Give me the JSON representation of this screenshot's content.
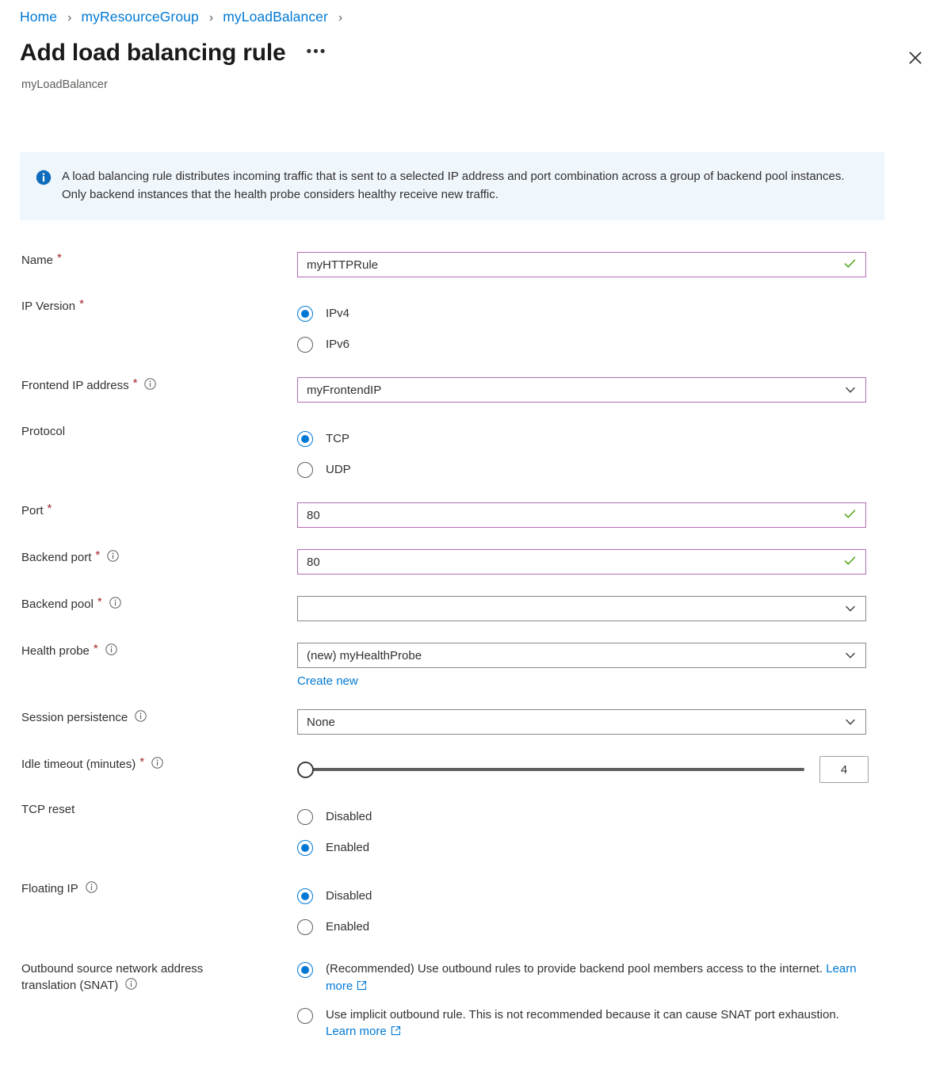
{
  "breadcrumb": {
    "items": [
      {
        "label": "Home"
      },
      {
        "label": "myResourceGroup"
      },
      {
        "label": "myLoadBalancer"
      }
    ],
    "separator": "›"
  },
  "header": {
    "title": "Add load balancing rule",
    "subtitle": "myLoadBalancer",
    "more_label": "•••",
    "close_label": "Close"
  },
  "info_banner": {
    "icon": "info-icon",
    "text": "A load balancing rule distributes incoming traffic that is sent to a selected IP address and port combination across a group of backend pool instances. Only backend instances that the health probe considers healthy receive new traffic."
  },
  "fields": {
    "name": {
      "label": "Name",
      "required": "*",
      "value": "myHTTPRule",
      "validated": true
    },
    "ip_version": {
      "label": "IP Version",
      "required": "*",
      "options": [
        {
          "label": "IPv4",
          "selected": true
        },
        {
          "label": "IPv6",
          "selected": false
        }
      ]
    },
    "frontend_ip": {
      "label": "Frontend IP address",
      "required": "*",
      "value": "myFrontendIP"
    },
    "protocol": {
      "label": "Protocol",
      "options": [
        {
          "label": "TCP",
          "selected": true
        },
        {
          "label": "UDP",
          "selected": false
        }
      ]
    },
    "port": {
      "label": "Port",
      "required": "*",
      "value": "80",
      "validated": true
    },
    "backend_port": {
      "label": "Backend port",
      "required": "*",
      "value": "80",
      "validated": true
    },
    "backend_pool": {
      "label": "Backend pool",
      "required": "*",
      "value": ""
    },
    "health_probe": {
      "label": "Health probe",
      "required": "*",
      "value": "(new) myHealthProbe",
      "create_new_label": "Create new"
    },
    "session_persistence": {
      "label": "Session persistence",
      "value": "None"
    },
    "idle_timeout": {
      "label": "Idle timeout (minutes)",
      "required": "*",
      "value": "4",
      "min": 4,
      "max": 30
    },
    "tcp_reset": {
      "label": "TCP reset",
      "options": [
        {
          "label": "Disabled",
          "selected": false
        },
        {
          "label": "Enabled",
          "selected": true
        }
      ]
    },
    "floating_ip": {
      "label": "Floating IP",
      "options": [
        {
          "label": "Disabled",
          "selected": true
        },
        {
          "label": "Enabled",
          "selected": false
        }
      ]
    },
    "snat": {
      "label_line1": "Outbound source network address",
      "label_line2": "translation (SNAT)",
      "options": [
        {
          "text": "(Recommended) Use outbound rules to provide backend pool members access to the internet.",
          "link_label": "Learn more",
          "selected": true
        },
        {
          "text": "Use implicit outbound rule. This is not recommended because it can cause SNAT port exhaustion.",
          "link_label": "Learn more",
          "selected": false
        }
      ]
    }
  },
  "colors": {
    "link": "#0078d4",
    "required_asterisk": "#a4262c",
    "validated_border": "#b46bb4",
    "valid_check": "#5ba822",
    "banner_bg": "#eff6fc",
    "radio_selected": "#0078d4"
  }
}
